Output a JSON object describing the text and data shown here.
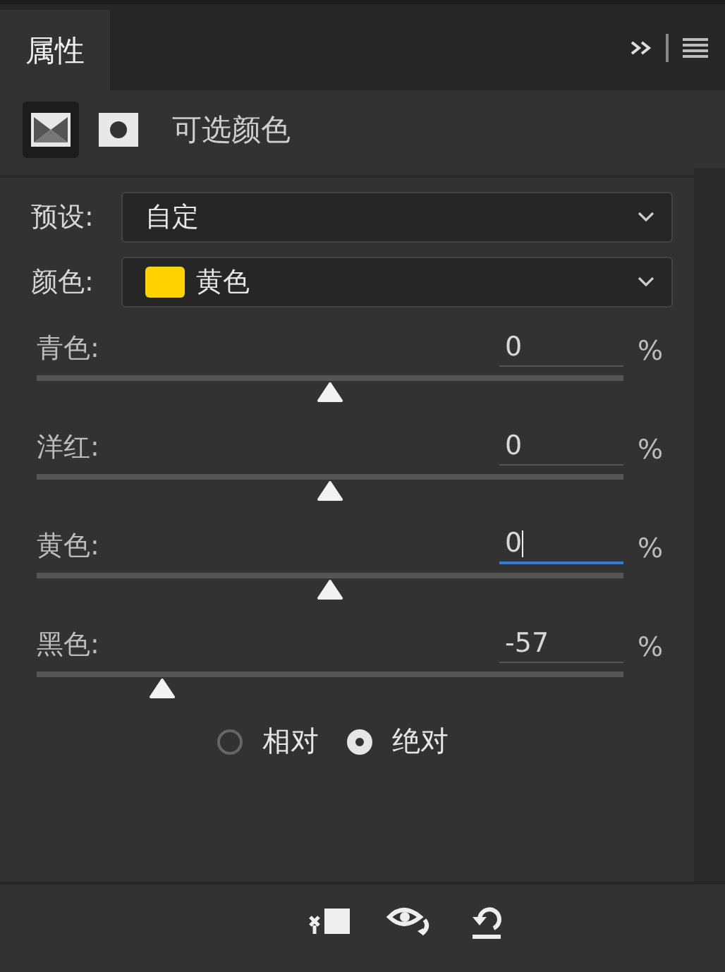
{
  "tabs": [
    {
      "label": "属性",
      "selected": true
    }
  ],
  "header": {
    "title": "可选颜色",
    "modes": [
      {
        "kind": "adjustment",
        "selected": true
      },
      {
        "kind": "mask",
        "selected": false
      }
    ]
  },
  "preset": {
    "label": "预设:",
    "value": "自定"
  },
  "colors": {
    "label": "颜色:",
    "value": "黄色",
    "color": "#ffd200"
  },
  "sliders": [
    {
      "name": "青色:",
      "value": "0",
      "unit": "%",
      "level": 0.5,
      "focused": false
    },
    {
      "name": "洋红:",
      "value": "0",
      "unit": "%",
      "level": 0.5,
      "focused": false
    },
    {
      "name": "黄色:",
      "value": "0",
      "unit": "%",
      "level": 0.5,
      "focused": true
    },
    {
      "name": "黑色:",
      "value": "-57",
      "unit": "%",
      "level": 0.215,
      "focused": false
    }
  ],
  "method": [
    {
      "label": "相对",
      "selected": false
    },
    {
      "label": "绝对",
      "selected": true
    }
  ],
  "toolbar": [
    {
      "kind": "clip"
    },
    {
      "kind": "view-previous"
    },
    {
      "kind": "reset"
    }
  ]
}
